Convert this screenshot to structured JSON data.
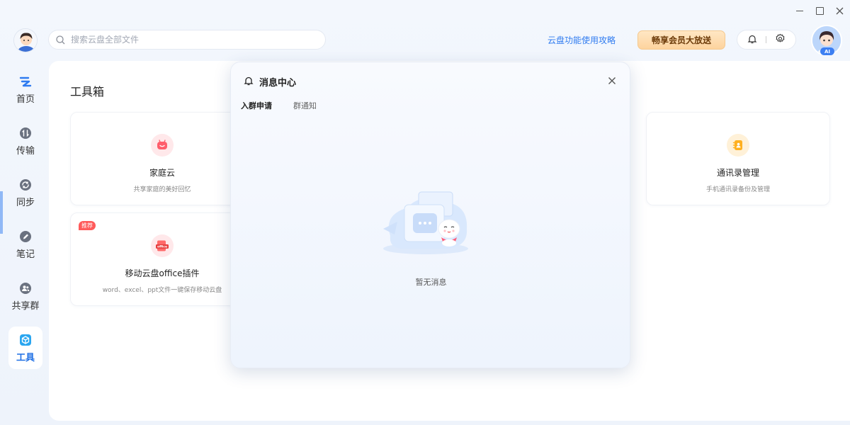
{
  "search": {
    "placeholder": "搜索云盘全部文件"
  },
  "header": {
    "guide_link": "云盘功能使用攻略",
    "vip_button": "畅享会员大放送",
    "ai_badge": "AI"
  },
  "nav": {
    "items": [
      {
        "label": "首页",
        "icon": "cloud-home-icon"
      },
      {
        "label": "传输",
        "icon": "transfer-icon"
      },
      {
        "label": "同步",
        "icon": "sync-icon"
      },
      {
        "label": "笔记",
        "icon": "note-icon"
      },
      {
        "label": "共享群",
        "icon": "share-group-icon"
      },
      {
        "label": "工具",
        "icon": "toolbox-icon",
        "active": true
      }
    ]
  },
  "main": {
    "title": "工具箱",
    "cards": [
      {
        "title": "家庭云",
        "desc": "共享家庭的美好回忆",
        "icon": "family-cloud-icon"
      },
      {
        "title": "通讯录管理",
        "desc": "手机通讯录备份及管理",
        "icon": "contacts-icon"
      },
      {
        "title": "移动云盘office插件",
        "desc": "word、excel、ppt文件一键保存移动云盘",
        "icon": "office-plugin-icon",
        "tag": "推荐"
      }
    ]
  },
  "panel": {
    "title": "消息中心",
    "tabs": [
      {
        "label": "入群申请",
        "active": true
      },
      {
        "label": "群通知",
        "active": false
      }
    ],
    "empty_text": "暂无消息"
  },
  "colors": {
    "accent": "#1f6fe5",
    "vip_bg": "#fdd39e",
    "tag_red": "#ff5a5a"
  }
}
